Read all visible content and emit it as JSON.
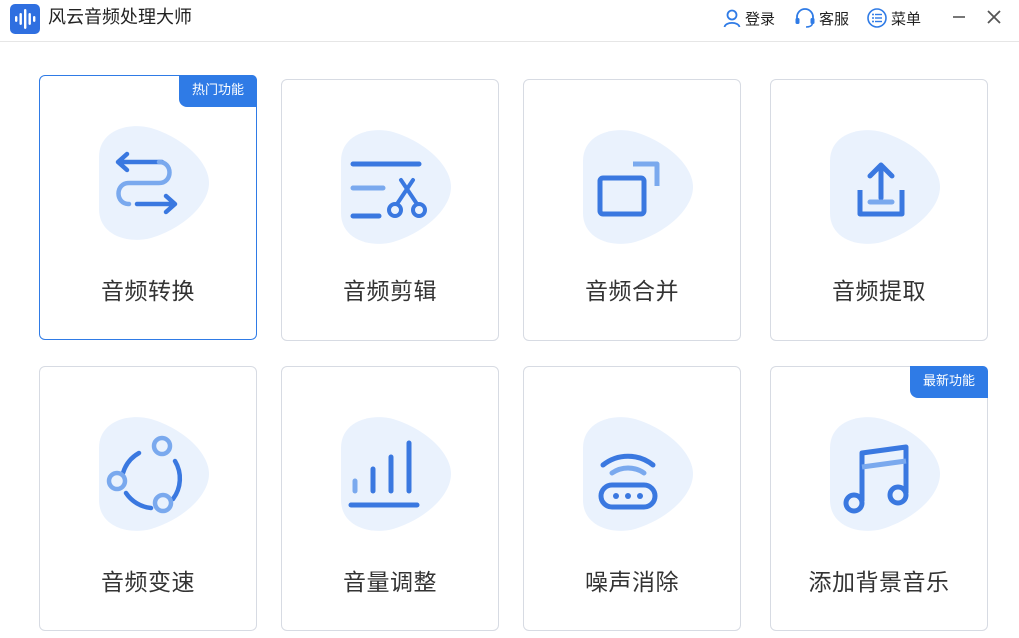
{
  "app": {
    "title": "风云音频处理大师"
  },
  "titlebar": {
    "login_label": "登录",
    "service_label": "客服",
    "menu_label": "菜单",
    "icons": [
      "user-icon",
      "headset-icon",
      "list-menu-icon",
      "minimize-icon",
      "close-icon"
    ]
  },
  "colors": {
    "accent": "#2f7be6",
    "blob": "#eaf2fd",
    "icon_primary": "#3a78e0",
    "icon_light": "#7aa9ee"
  },
  "cards": [
    {
      "label": "音频转换",
      "badge": "热门功能",
      "icon": "convert-arrows-icon",
      "selected": true
    },
    {
      "label": "音频剪辑",
      "badge": "",
      "icon": "scissors-edit-icon",
      "selected": false
    },
    {
      "label": "音频合并",
      "badge": "",
      "icon": "merge-windows-icon",
      "selected": false
    },
    {
      "label": "音频提取",
      "badge": "",
      "icon": "extract-upload-icon",
      "selected": false
    },
    {
      "label": "音频变速",
      "badge": "",
      "icon": "speed-cycle-icon",
      "selected": false
    },
    {
      "label": "音量调整",
      "badge": "",
      "icon": "volume-bars-icon",
      "selected": false
    },
    {
      "label": "噪声消除",
      "badge": "",
      "icon": "noise-router-icon",
      "selected": false
    },
    {
      "label": "添加背景音乐",
      "badge": "最新功能",
      "icon": "music-note-icon",
      "selected": false
    }
  ]
}
